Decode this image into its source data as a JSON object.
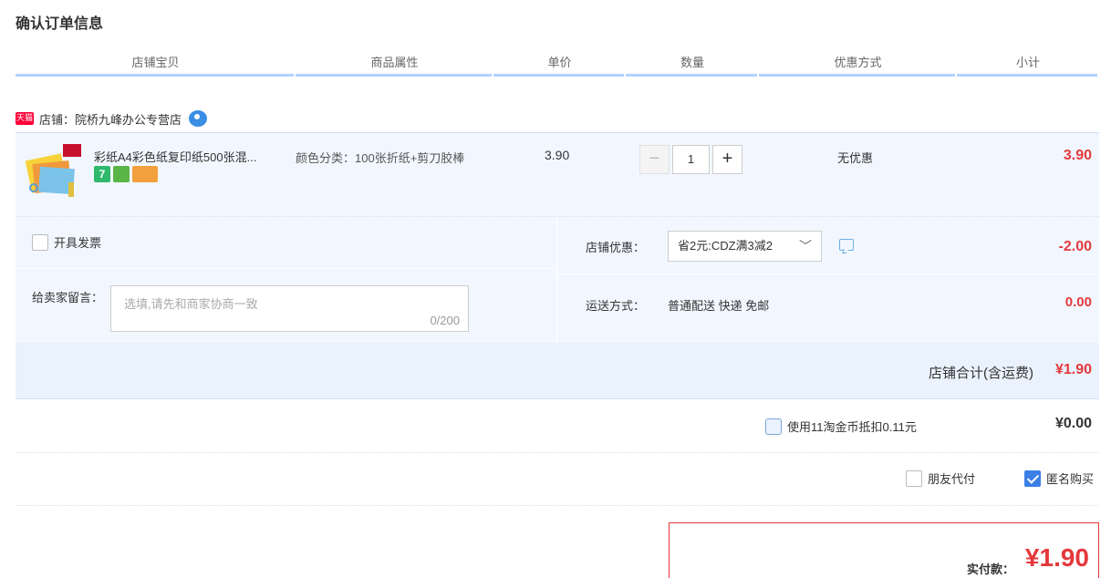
{
  "page_title": "确认订单信息",
  "columns": [
    "店铺宝贝",
    "商品属性",
    "单价",
    "数量",
    "优惠方式",
    "小计"
  ],
  "shop": {
    "badge": "天猫",
    "name": "店铺：院桥九峰办公专营店"
  },
  "item": {
    "title": "彩纸A4彩色纸复印纸500张混...",
    "attribute": "颜色分类：100张折纸+剪刀胶棒",
    "price": "3.90",
    "quantity": "1",
    "discount": "无优惠",
    "subtotal": "3.90",
    "service_icons": [
      "7",
      "",
      ""
    ]
  },
  "invoice": {
    "label": "开具发票"
  },
  "message": {
    "label": "给卖家留言：",
    "placeholder": "选填,请先和商家协商一致",
    "count": "0/200"
  },
  "shop_coupon": {
    "label": "店铺优惠：",
    "selected": "省2元:CDZ满3减2",
    "amount": "-2.00"
  },
  "shipping": {
    "label": "运送方式：",
    "value": "普通配送 快递 免邮",
    "amount": "0.00"
  },
  "shop_total": {
    "label": "店铺合计(含运费)",
    "amount": "¥1.90"
  },
  "coins": {
    "label": "使用11淘金币抵扣0.11元",
    "amount": "¥0.00"
  },
  "options": {
    "friend_pay": "朋友代付",
    "anonymous": "匿名购买"
  },
  "payment": {
    "label": "实付款：",
    "amount": "¥1.90"
  },
  "colors": {
    "accent_red": "#e4393c",
    "header_bar": "#b2d1ff",
    "row_bg": "#f2f7ff"
  }
}
